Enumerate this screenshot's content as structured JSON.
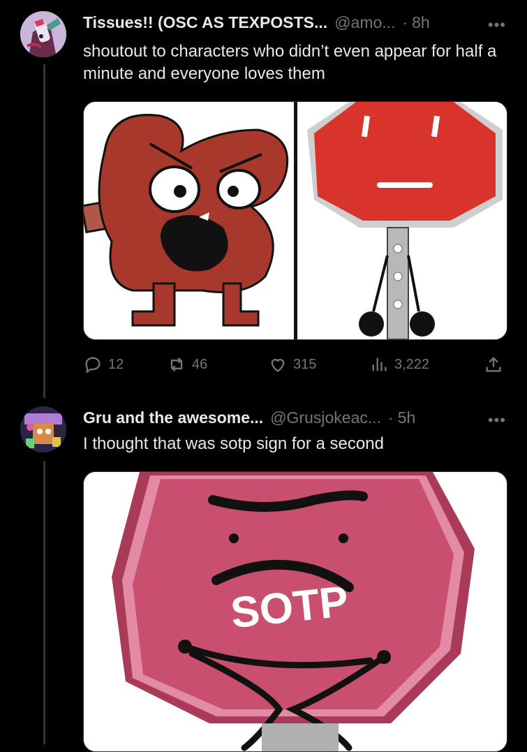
{
  "tweets": [
    {
      "name": "Tissues!! (OSC AS TEXPOSTS...",
      "handle": "@amo...",
      "time": "8h",
      "text": "shoutout to characters who didn’t even appear for half a minute and everyone loves them",
      "replies": "12",
      "reposts": "46",
      "likes": "315",
      "views": "3,222"
    },
    {
      "name": "Gru and the awesome...",
      "handle": "@Grusjokeac...",
      "time": "5h",
      "text": "I thought that was sotp sign for a second",
      "image_caption": "SOTP"
    }
  ],
  "separator": "·",
  "more": "•••",
  "icons": [
    "reply-icon",
    "repost-icon",
    "like-icon",
    "views-icon",
    "share-icon"
  ],
  "colors": {
    "background": "#000000",
    "text": "#e7e9ea",
    "muted": "#71767b",
    "stop_red": "#d9342b",
    "kidney_red": "#a8382c",
    "pink_sign": "#c8506e"
  }
}
